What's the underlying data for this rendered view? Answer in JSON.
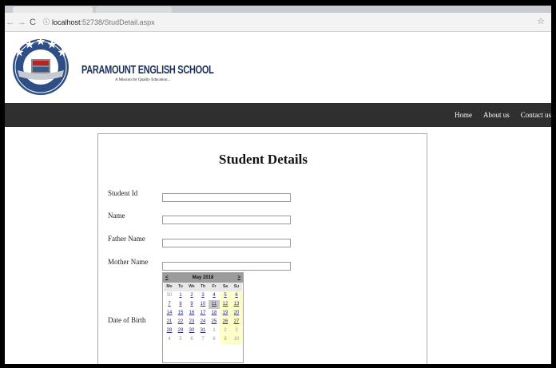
{
  "browser": {
    "url_host": "localhost",
    "url_path": ":52738/StudDetail.aspx"
  },
  "header": {
    "school_name": "PARAMOUNT ENGLISH SCHOOL",
    "tagline": "A Mission for Quality Education..."
  },
  "nav": {
    "items": [
      "Home",
      "About us",
      "Contact us"
    ]
  },
  "form": {
    "title": "Student Details",
    "labels": {
      "student_id": "Student Id",
      "name": "Name",
      "father_name": "Father Name",
      "mother_name": "Mother Name",
      "dob": "Date of Birth"
    }
  },
  "calendar": {
    "prev": "<",
    "next": ">",
    "month_title": "May 2018",
    "days_of_week": [
      "Mo",
      "Tu",
      "We",
      "Th",
      "Fr",
      "Sa",
      "Su"
    ],
    "selected_day": "11",
    "weeks": [
      [
        "30",
        "1",
        "2",
        "3",
        "4",
        "5",
        "6"
      ],
      [
        "7",
        "8",
        "9",
        "10",
        "11",
        "12",
        "13"
      ],
      [
        "14",
        "15",
        "16",
        "17",
        "18",
        "19",
        "20"
      ],
      [
        "21",
        "22",
        "23",
        "24",
        "25",
        "26",
        "27"
      ],
      [
        "28",
        "29",
        "30",
        "31",
        "1",
        "2",
        "3"
      ],
      [
        "4",
        "5",
        "6",
        "7",
        "8",
        "9",
        "10"
      ]
    ]
  },
  "icons": {
    "back": "arrow-left-icon",
    "forward": "arrow-right-icon",
    "reload": "reload-icon",
    "info": "info-icon",
    "bookmark": "star-icon"
  }
}
